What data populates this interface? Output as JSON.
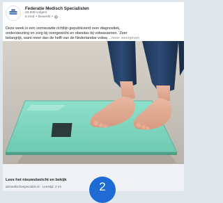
{
  "post": {
    "author": "Federatie Medisch Specialisten",
    "followers": "23.609 volgers",
    "time": "6 mnd",
    "edited": "Bewerkt",
    "separator": "•",
    "globe_icon": "globe-icon",
    "text_line1": "Deze week is een vernieuwde richtlijn gepubliceerd over diagnostiek,",
    "text_line2": "ondersteuning en zorg bij overgewicht en obesitas bij volwassenen. 'Zeer",
    "text_line3": "belangrijk, want meer dan de helft van de Nederlandse volwa",
    "see_more": "...meer weergeven"
  },
  "link_preview": {
    "title": "Lees het nieuwsbericht en bekijk",
    "source": "demedischespecialist.nl",
    "read_time": "Leestijd: 2 mi"
  },
  "badge": {
    "count": "2",
    "color": "#1e6bd6"
  },
  "photo": {
    "subject": "feet-on-bathroom-scale",
    "scale_color": "#7fd8c1"
  }
}
